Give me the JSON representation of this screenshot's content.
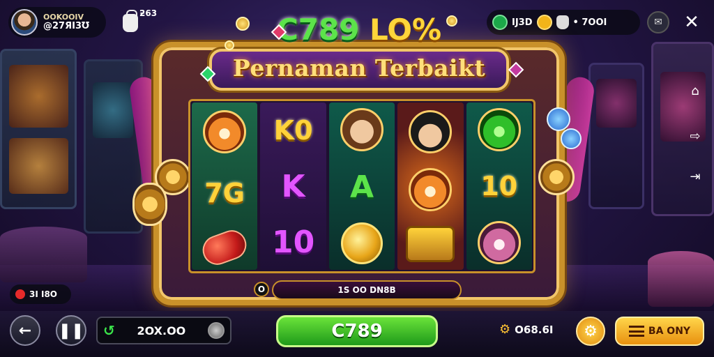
{
  "profile": {
    "name": "OOKOOIV",
    "balance": "@27ЯI3Ʊ"
  },
  "bag_count": "ƻ63",
  "stats": {
    "gems": "ӀЈ3D",
    "credits": "• 7OOI"
  },
  "logo": {
    "main": "C789 ",
    "suffix": "LO%"
  },
  "subtitle": "Pernaman Terbaikt",
  "reels": [
    [
      "tiger",
      "7G",
      "pill"
    ],
    [
      "K0",
      "K",
      "10"
    ],
    [
      "man",
      "A",
      "coin"
    ],
    [
      "man2",
      "tiger",
      "chest"
    ],
    [
      "cat-g",
      "10",
      "cat-p"
    ]
  ],
  "win": {
    "count": "O",
    "label": "1S OO DN8B"
  },
  "hearts": "3I I8O",
  "bet": {
    "value": "2OX.OO"
  },
  "spin_label": "C789",
  "balance": "O68.6I",
  "buy_label": "BA ONY",
  "colors": {
    "accent": "#f2c66a",
    "spin": "#3ac52a",
    "logo": "#5ce34a"
  }
}
